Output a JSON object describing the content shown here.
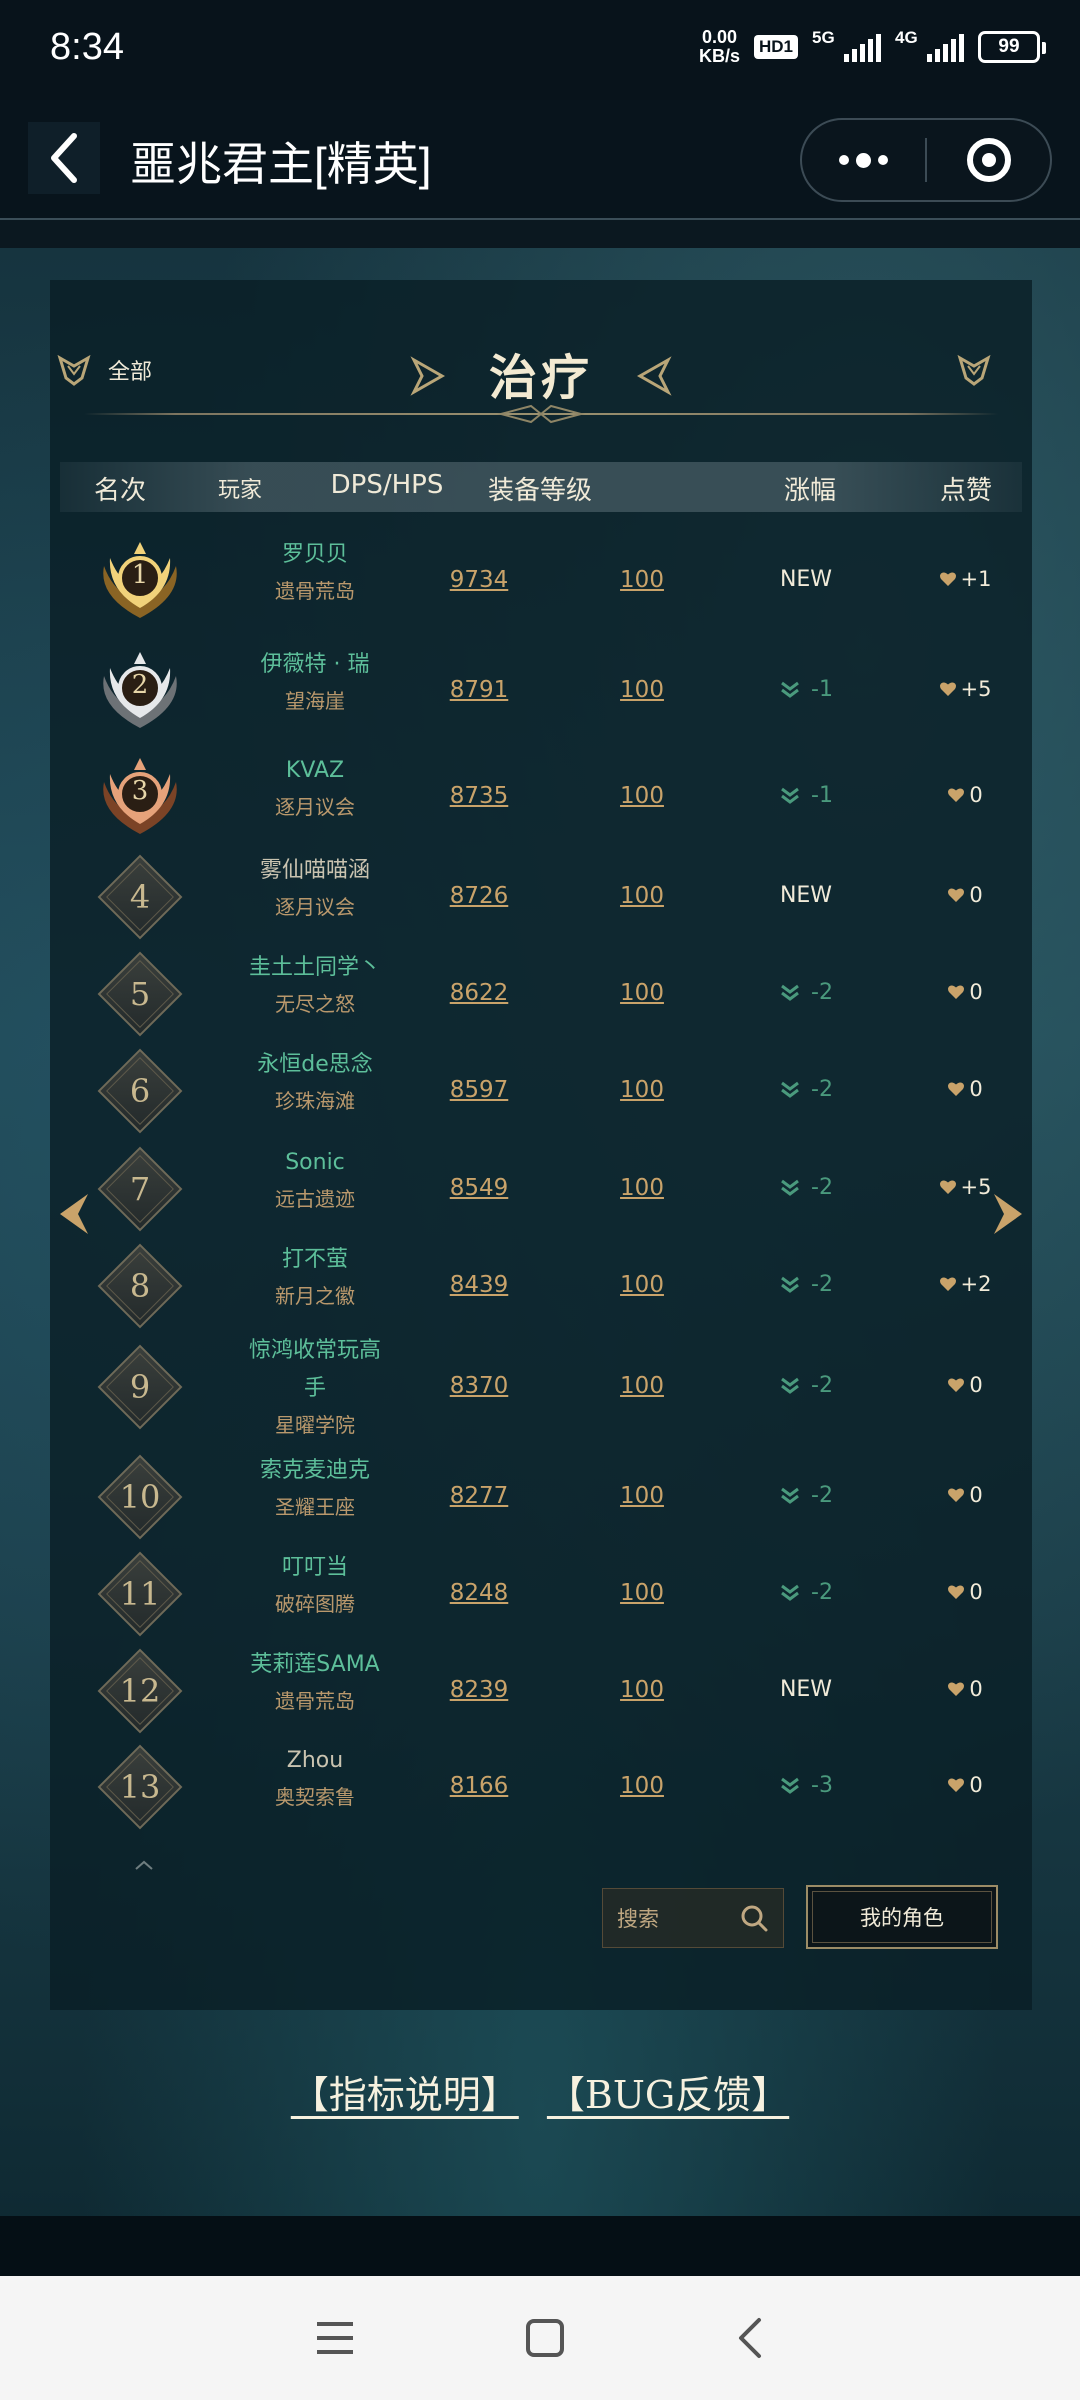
{
  "status": {
    "time": "8:34",
    "net_speed_value": "0.00",
    "net_speed_unit": "KB/s",
    "hd": "HD1",
    "sig1_label": "5G",
    "sig2_label": "4G",
    "battery": "99"
  },
  "header": {
    "title": "噩兆君主[精英]"
  },
  "filter": {
    "all_label": "全部",
    "category": "治疗"
  },
  "columns": {
    "rank": "名次",
    "player": "玩家",
    "dps": "DPS/HPS",
    "gear": "装备等级",
    "change": "涨幅",
    "likes": "点赞"
  },
  "rows": [
    {
      "rank": "1",
      "name": "罗贝贝",
      "server": "遗骨荒岛",
      "dps": "9734",
      "gear": "100",
      "change": "NEW",
      "likes": "+1"
    },
    {
      "rank": "2",
      "name": "伊薇特 · 瑞",
      "server": "望海崖",
      "dps": "8791",
      "gear": "100",
      "change": "-1",
      "likes": "+5"
    },
    {
      "rank": "3",
      "name": "KVAZ",
      "server": "逐月议会",
      "dps": "8735",
      "gear": "100",
      "change": "-1",
      "likes": "0"
    },
    {
      "rank": "4",
      "name": "雾仙喵喵涵",
      "server": "逐月议会",
      "dps": "8726",
      "gear": "100",
      "change": "NEW",
      "likes": "0"
    },
    {
      "rank": "5",
      "name": "圭土土同学丶",
      "server": "无尽之怒",
      "dps": "8622",
      "gear": "100",
      "change": "-2",
      "likes": "0"
    },
    {
      "rank": "6",
      "name": "永恒de思念",
      "server": "珍珠海滩",
      "dps": "8597",
      "gear": "100",
      "change": "-2",
      "likes": "0"
    },
    {
      "rank": "7",
      "name": "Sonic",
      "server": "远古遗迹",
      "dps": "8549",
      "gear": "100",
      "change": "-2",
      "likes": "+5"
    },
    {
      "rank": "8",
      "name": "打不萤",
      "server": "新月之徽",
      "dps": "8439",
      "gear": "100",
      "change": "-2",
      "likes": "+2"
    },
    {
      "rank": "9",
      "name": "惊鸿收常玩高",
      "name2": "手",
      "server": "星曜学院",
      "dps": "8370",
      "gear": "100",
      "change": "-2",
      "likes": "0"
    },
    {
      "rank": "10",
      "name": "索克麦迪克",
      "server": "圣耀王座",
      "dps": "8277",
      "gear": "100",
      "change": "-2",
      "likes": "0"
    },
    {
      "rank": "11",
      "name": "叮叮当",
      "server": "破碎图腾",
      "dps": "8248",
      "gear": "100",
      "change": "-2",
      "likes": "0"
    },
    {
      "rank": "12",
      "name": "芙莉莲SAMA",
      "server": "遗骨荒岛",
      "dps": "8239",
      "gear": "100",
      "change": "NEW",
      "likes": "0"
    },
    {
      "rank": "13",
      "name": "Zhou",
      "server": "奥契索鲁",
      "dps": "8166",
      "gear": "100",
      "change": "-3",
      "likes": "0"
    }
  ],
  "actions": {
    "search_label": "搜索",
    "my_character_label": "我的角色"
  },
  "footer": {
    "metrics_link": "【指标说明】",
    "bug_link": "【BUG反馈】"
  },
  "colors": {
    "accent_gold": "#c9a36a",
    "name_green": "#5dbf9a",
    "change_green": "#4a9a7d"
  },
  "icons": {
    "back": "back-chevron-icon",
    "more": "more-dots-icon",
    "close": "target-circle-icon",
    "search": "search-icon",
    "rank_down": "double-chevron-down-icon",
    "like": "heart-icon"
  }
}
